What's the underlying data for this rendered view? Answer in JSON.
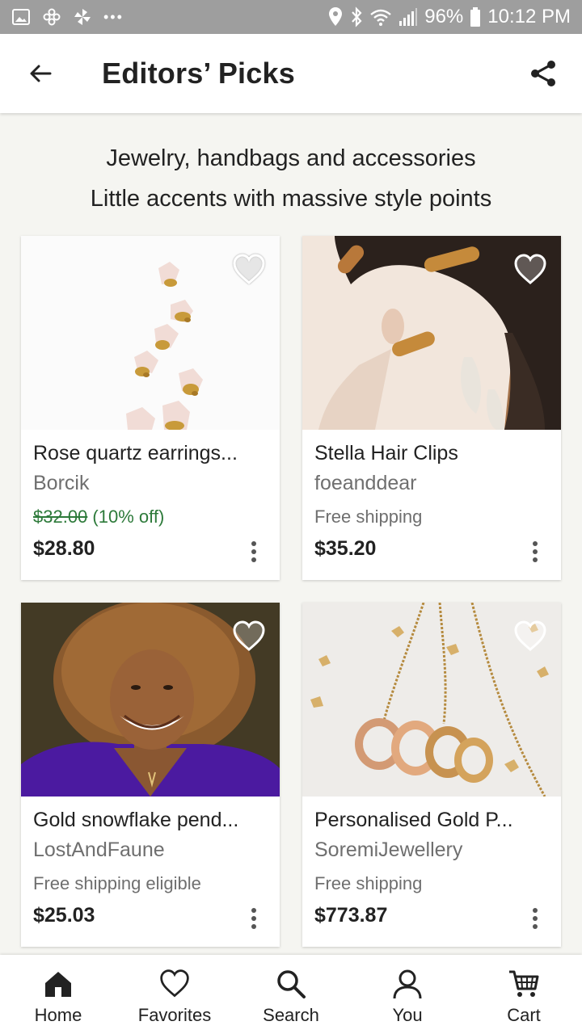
{
  "status_bar": {
    "battery": "96%",
    "time": "10:12 PM",
    "more": "•••",
    "icons": [
      "image-icon",
      "pinwheel-icon",
      "fan-icon",
      "location-icon",
      "bluetooth-icon",
      "wifi-icon",
      "signal-icon",
      "battery-icon"
    ]
  },
  "app_bar": {
    "title": "Editors’ Picks",
    "back_icon": "back-arrow-icon",
    "share_icon": "share-icon"
  },
  "heading": {
    "title": "Jewelry, handbags and accessories",
    "subtitle": "Little accents with massive style points"
  },
  "colors": {
    "accent_green": "#2d7a3a",
    "status_bar": "#9e9e9e",
    "background": "#f5f5f1"
  },
  "products": [
    {
      "title": "Rose quartz earrings...",
      "shop": "Borcik",
      "original_price": "$32.00",
      "discount": "(10% off)",
      "price": "$28.80",
      "image": "rose-quartz-earrings"
    },
    {
      "title": "Stella Hair Clips",
      "shop": "foeanddear",
      "shipping": "Free shipping",
      "price": "$35.20",
      "image": "hair-clips"
    },
    {
      "title": "Gold snowflake pend...",
      "shop": "LostAndFaune",
      "shipping": "Free shipping eligible",
      "price": "$25.03",
      "image": "woman-portrait"
    },
    {
      "title": "Personalised Gold P...",
      "shop": "SoremiJewellery",
      "shipping": "Free shipping",
      "price": "$773.87",
      "image": "gold-rings-necklace"
    }
  ],
  "bottom_nav": [
    {
      "label": "Home",
      "icon": "home-icon",
      "active": true
    },
    {
      "label": "Favorites",
      "icon": "heart-icon"
    },
    {
      "label": "Search",
      "icon": "search-icon"
    },
    {
      "label": "You",
      "icon": "person-icon"
    },
    {
      "label": "Cart",
      "icon": "cart-icon"
    }
  ]
}
